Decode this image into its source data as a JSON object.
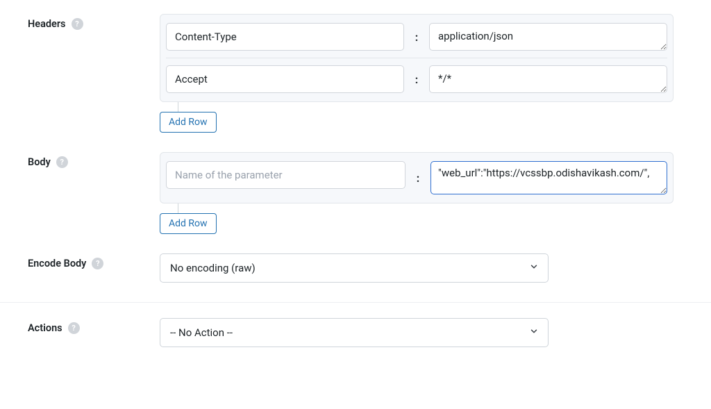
{
  "headers": {
    "label": "Headers",
    "rows": [
      {
        "key": "Content-Type",
        "value": "application/json"
      },
      {
        "key": "Accept",
        "value": "*/*"
      }
    ],
    "add_row_label": "Add Row"
  },
  "body": {
    "label": "Body",
    "rows": [
      {
        "key": "",
        "key_placeholder": "Name of the parameter",
        "value": "\"web_url\":\"https://vcssbp.odishavikash.com/\","
      }
    ],
    "add_row_label": "Add Row"
  },
  "encode_body": {
    "label": "Encode Body",
    "value": "No encoding (raw)"
  },
  "actions": {
    "label": "Actions",
    "value": "-- No Action --"
  },
  "help_glyph": "?"
}
